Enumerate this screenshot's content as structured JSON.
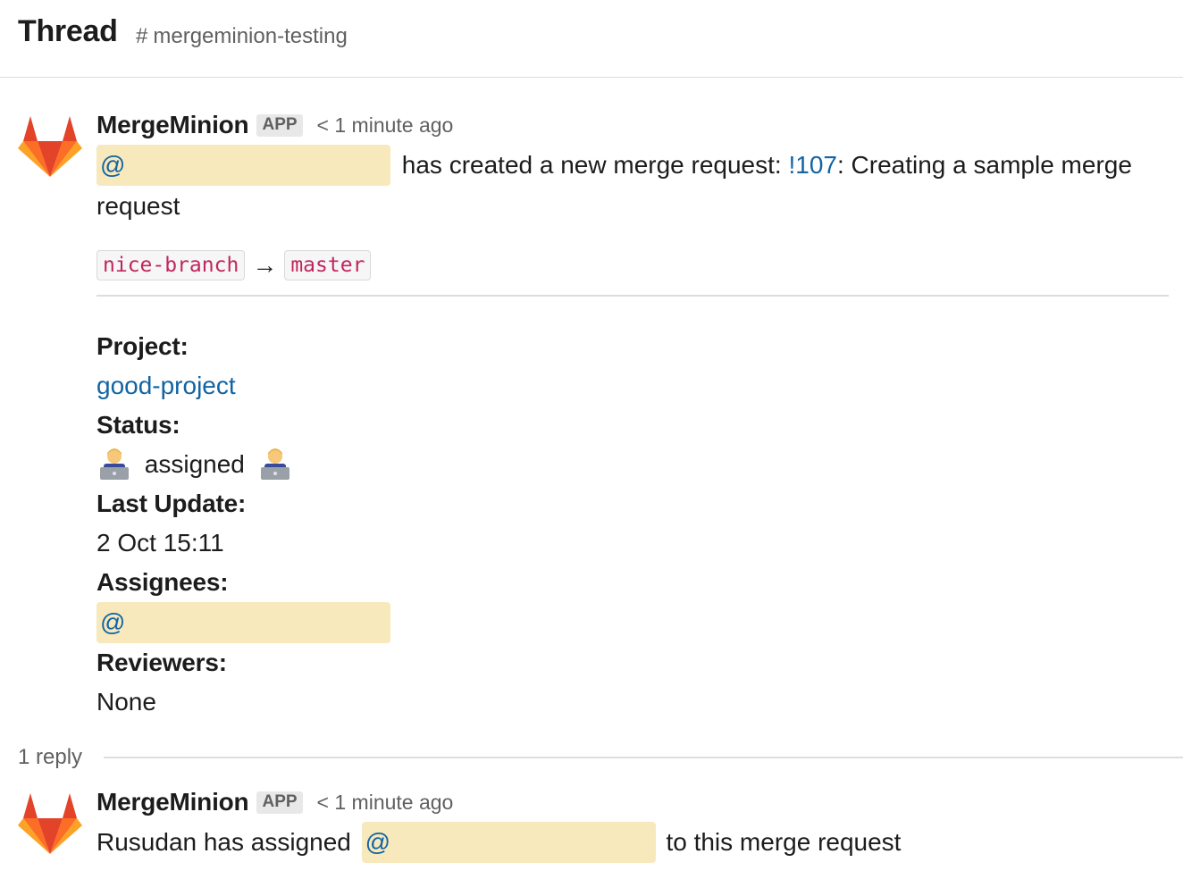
{
  "header": {
    "title": "Thread",
    "channel_icon": "#",
    "channel_name": "mergeminion-testing"
  },
  "messages": [
    {
      "sender": "MergeMinion",
      "badge": "APP",
      "timestamp": "< 1 minute ago",
      "mention": "@",
      "text_before_link": "has created a new merge request:",
      "mr_link": "!107",
      "text_after_link": ": Creating a sample merge",
      "text_wrap": "request",
      "source_branch": "nice-branch",
      "arrow": "→",
      "target_branch": "master",
      "fields": {
        "project_label": "Project:",
        "project_value": "good-project",
        "status_label": "Status:",
        "status_value": "assigned",
        "status_emoji": "technologist-emoji",
        "last_update_label": "Last Update:",
        "last_update_value": "2 Oct 15:11",
        "assignees_label": "Assignees:",
        "assignee_mention": "@",
        "reviewers_label": "Reviewers:",
        "reviewers_value": "None"
      }
    },
    {
      "sender": "MergeMinion",
      "badge": "APP",
      "timestamp": "< 1 minute ago",
      "text_before": "Rusudan has assigned",
      "mention": "@",
      "text_after": "to this merge request"
    }
  ],
  "thread": {
    "reply_count": "1 reply"
  },
  "colors": {
    "link": "#1264a3",
    "mention_bg": "#f8e9bc",
    "code_text": "#c0265d",
    "divider": "#dddddd",
    "muted": "#616061"
  }
}
